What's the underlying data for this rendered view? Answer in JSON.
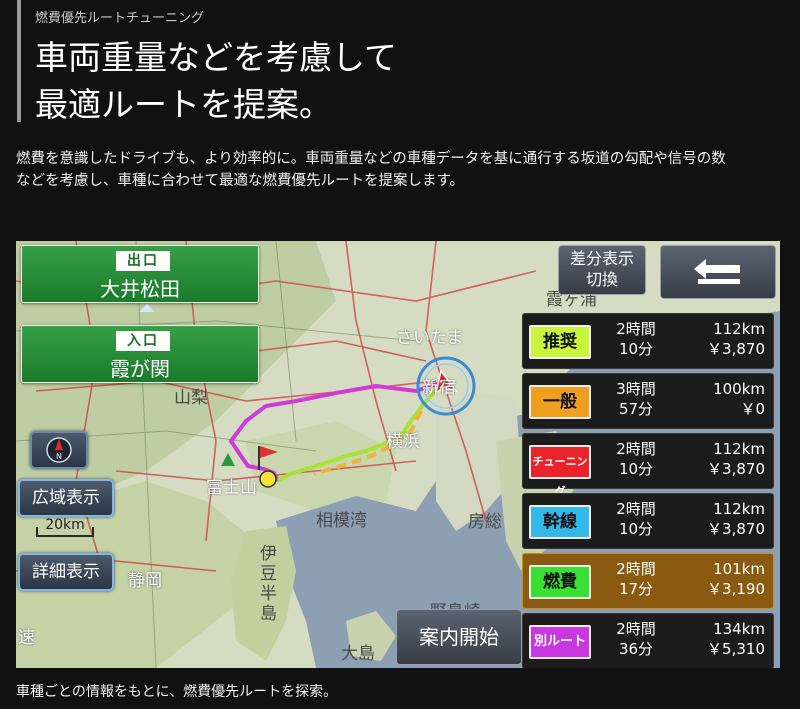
{
  "header": {
    "kicker": "燃費優先ルートチューニング",
    "title_line1": "車両重量などを考慮して",
    "title_line2": "最適ルートを提案。"
  },
  "description_line1": "燃費を意識したドライブも、より効率的に。車両重量などの車種データを基に通行する坂道の勾配や信号の数",
  "description_line2": "などを考慮し、車種に合わせて最適な燃費優先ルートを提案します。",
  "caption": "車種ごとの情報をもとに、燃費優先ルートを探索。",
  "nav": {
    "exit_tag": "出口",
    "exit_name": "大井松田",
    "entrance_tag": "入口",
    "entrance_name": "霞が関",
    "compass_letter": "N",
    "wide_view_label": "広域表示",
    "scale_label": "20km",
    "detail_view_label": "詳細表示",
    "diff_display_line1": "差分表示",
    "diff_display_line2": "切換",
    "back_icon": "back-arrow-icon",
    "start_guidance_label": "案内開始",
    "map_labels": {
      "saitama": "さいたま",
      "shinjuku": "新宿",
      "yokohama": "横浜",
      "fujisan": "富士山",
      "sagamiwan": "相模湾",
      "izu1": "伊",
      "izu2": "豆",
      "izu3": "半",
      "izu4": "島",
      "shizuoka": "静岡",
      "oshima": "大島",
      "boso": "房総",
      "kasumi": "霞ヶ浦",
      "yamanashi": "山梨",
      "hayaku": "速",
      "nohara": "野島崎"
    },
    "routes": [
      {
        "name": "推奨",
        "time1": "2時間",
        "time2": "10分",
        "dist": "112km",
        "cost": "￥3,870",
        "color": "#c8f53c",
        "selected": false
      },
      {
        "name": "一般",
        "time1": "3時間",
        "time2": "57分",
        "dist": "100km",
        "cost": "￥0",
        "color": "#f0a020",
        "selected": false
      },
      {
        "name": "チューニング",
        "time1": "2時間",
        "time2": "10分",
        "dist": "112km",
        "cost": "￥3,870",
        "color": "#e8242a",
        "selected": false
      },
      {
        "name": "幹線",
        "time1": "2時間",
        "time2": "10分",
        "dist": "112km",
        "cost": "￥3,870",
        "color": "#34b8e8",
        "selected": false
      },
      {
        "name": "燃費",
        "time1": "2時間",
        "time2": "17分",
        "dist": "101km",
        "cost": "￥3,190",
        "color": "#39e034",
        "selected": true
      },
      {
        "name": "別ルート",
        "time1": "2時間",
        "time2": "36分",
        "dist": "134km",
        "cost": "￥5,310",
        "color": "#c838e0",
        "selected": false
      }
    ]
  }
}
